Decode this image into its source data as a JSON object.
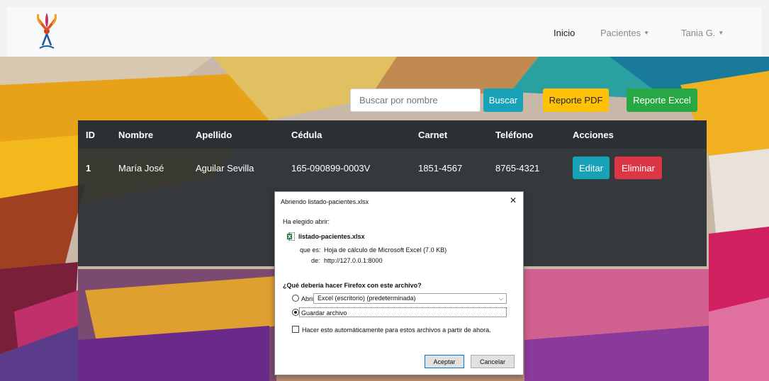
{
  "nav": {
    "home": "Inicio",
    "patients": "Pacientes",
    "user": "Tania G."
  },
  "search": {
    "placeholder": "Buscar por nombre",
    "search_button": "Buscar",
    "pdf_button": "Reporte PDF",
    "excel_button": "Reporte Excel"
  },
  "table": {
    "headers": [
      "ID",
      "Nombre",
      "Apellido",
      "Cédula",
      "Carnet",
      "Teléfono",
      "Acciones"
    ],
    "rows": [
      {
        "id": "1",
        "nombre": "María José",
        "apellido": "Aguilar Sevilla",
        "cedula": "165-090899-0003V",
        "carnet": "1851-4567",
        "telefono": "8765-4321",
        "edit_label": "Editar",
        "delete_label": "Eliminar"
      }
    ]
  },
  "dialog": {
    "title": "Abriendo listado-pacientes.xlsx",
    "chosen_label": "Ha elegido abrir:",
    "filename": "listado-pacientes.xlsx",
    "type_label": "que es:",
    "type_value": "Hoja de cálculo de Microsoft Excel (7.0 KB)",
    "from_label": "de:",
    "from_value": "http://127.0.0.1:8000",
    "question": "¿Qué debería hacer Firefox con este archivo?",
    "open_with_label": "Abrir con",
    "open_with_value": "Excel (escritorio) (predeterminada)",
    "save_label": "Guardar archivo",
    "auto_label": "Hacer esto automáticamente para estos archivos a partir de ahora.",
    "accept_label": "Aceptar",
    "cancel_label": "Cancelar",
    "selected_option": "save"
  },
  "colors": {
    "info": "#17a2b8",
    "warning": "#ffc107",
    "success": "#28a745",
    "danger": "#dc3545",
    "table_dark": "#343a40"
  }
}
